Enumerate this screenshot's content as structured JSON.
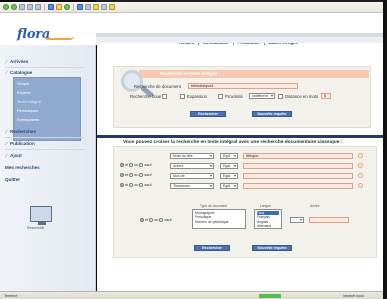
{
  "toolbar": {
    "icons": [
      "back-icon",
      "forward-icon",
      "stop-icon",
      "refresh-icon",
      "home-icon",
      "search-icon",
      "favorites-icon",
      "history-icon",
      "mail-icon",
      "print-icon",
      "edit-icon",
      "discuss-icon",
      "messenger-icon"
    ]
  },
  "header": {
    "logo": "flora",
    "nav": [
      "Accueil",
      "Consultation",
      "Production",
      "Bases en ligne"
    ]
  },
  "sidebar": {
    "items": [
      "Arrivées",
      "Catalogue",
      "Recherches",
      "Publication",
      "Ajout",
      "Mes recherches",
      "Quitter"
    ],
    "subitems": [
      "Simple",
      "Experte",
      "Texte intégral",
      "Périodiques",
      "Exemplaires"
    ],
    "monitor_label": "Ressemble"
  },
  "simple": {
    "title": "Recherche en texte intégral",
    "doc_label": "Recherche de document",
    "doc_value": "bibliothèques",
    "type_label": "Recherche floue",
    "option_expansion": "Expansion",
    "option_proximite": "Proximité",
    "proximite_value": "indifférent",
    "distance_label": "Distance en mots",
    "distance_value": "5",
    "btn_search": "Rechercher",
    "btn_new": "Nouvelle requête"
  },
  "advanced": {
    "title": "Vous pouvez croiser la recherche en texte intégral avec une recherche documentaire classique :",
    "op_et": "et",
    "op_ou": "ou",
    "op_sauf": "sauf",
    "rows": [
      {
        "field": "Mots du titre",
        "op": "Égal",
        "value": "éthique"
      },
      {
        "field": "Auteur",
        "op": "Égal",
        "value": ""
      },
      {
        "field": "Mot-clé",
        "op": "Égal",
        "value": ""
      },
      {
        "field": "Thesaurus",
        "op": "Égal",
        "value": ""
      }
    ],
    "type_doc_head": "Type de document",
    "type_doc_items": [
      "Monographie",
      "Périodique",
      "Numéro de périodique"
    ],
    "langue_head": "Langue",
    "langue_items": [
      "Tous",
      "Français",
      "Anglais",
      "Allemand"
    ],
    "annee_head": "Année",
    "btn_search": "Rechercher",
    "btn_new": "Nouvelle requête"
  },
  "status": {
    "left": "Terminé",
    "right": "Intranet local"
  }
}
